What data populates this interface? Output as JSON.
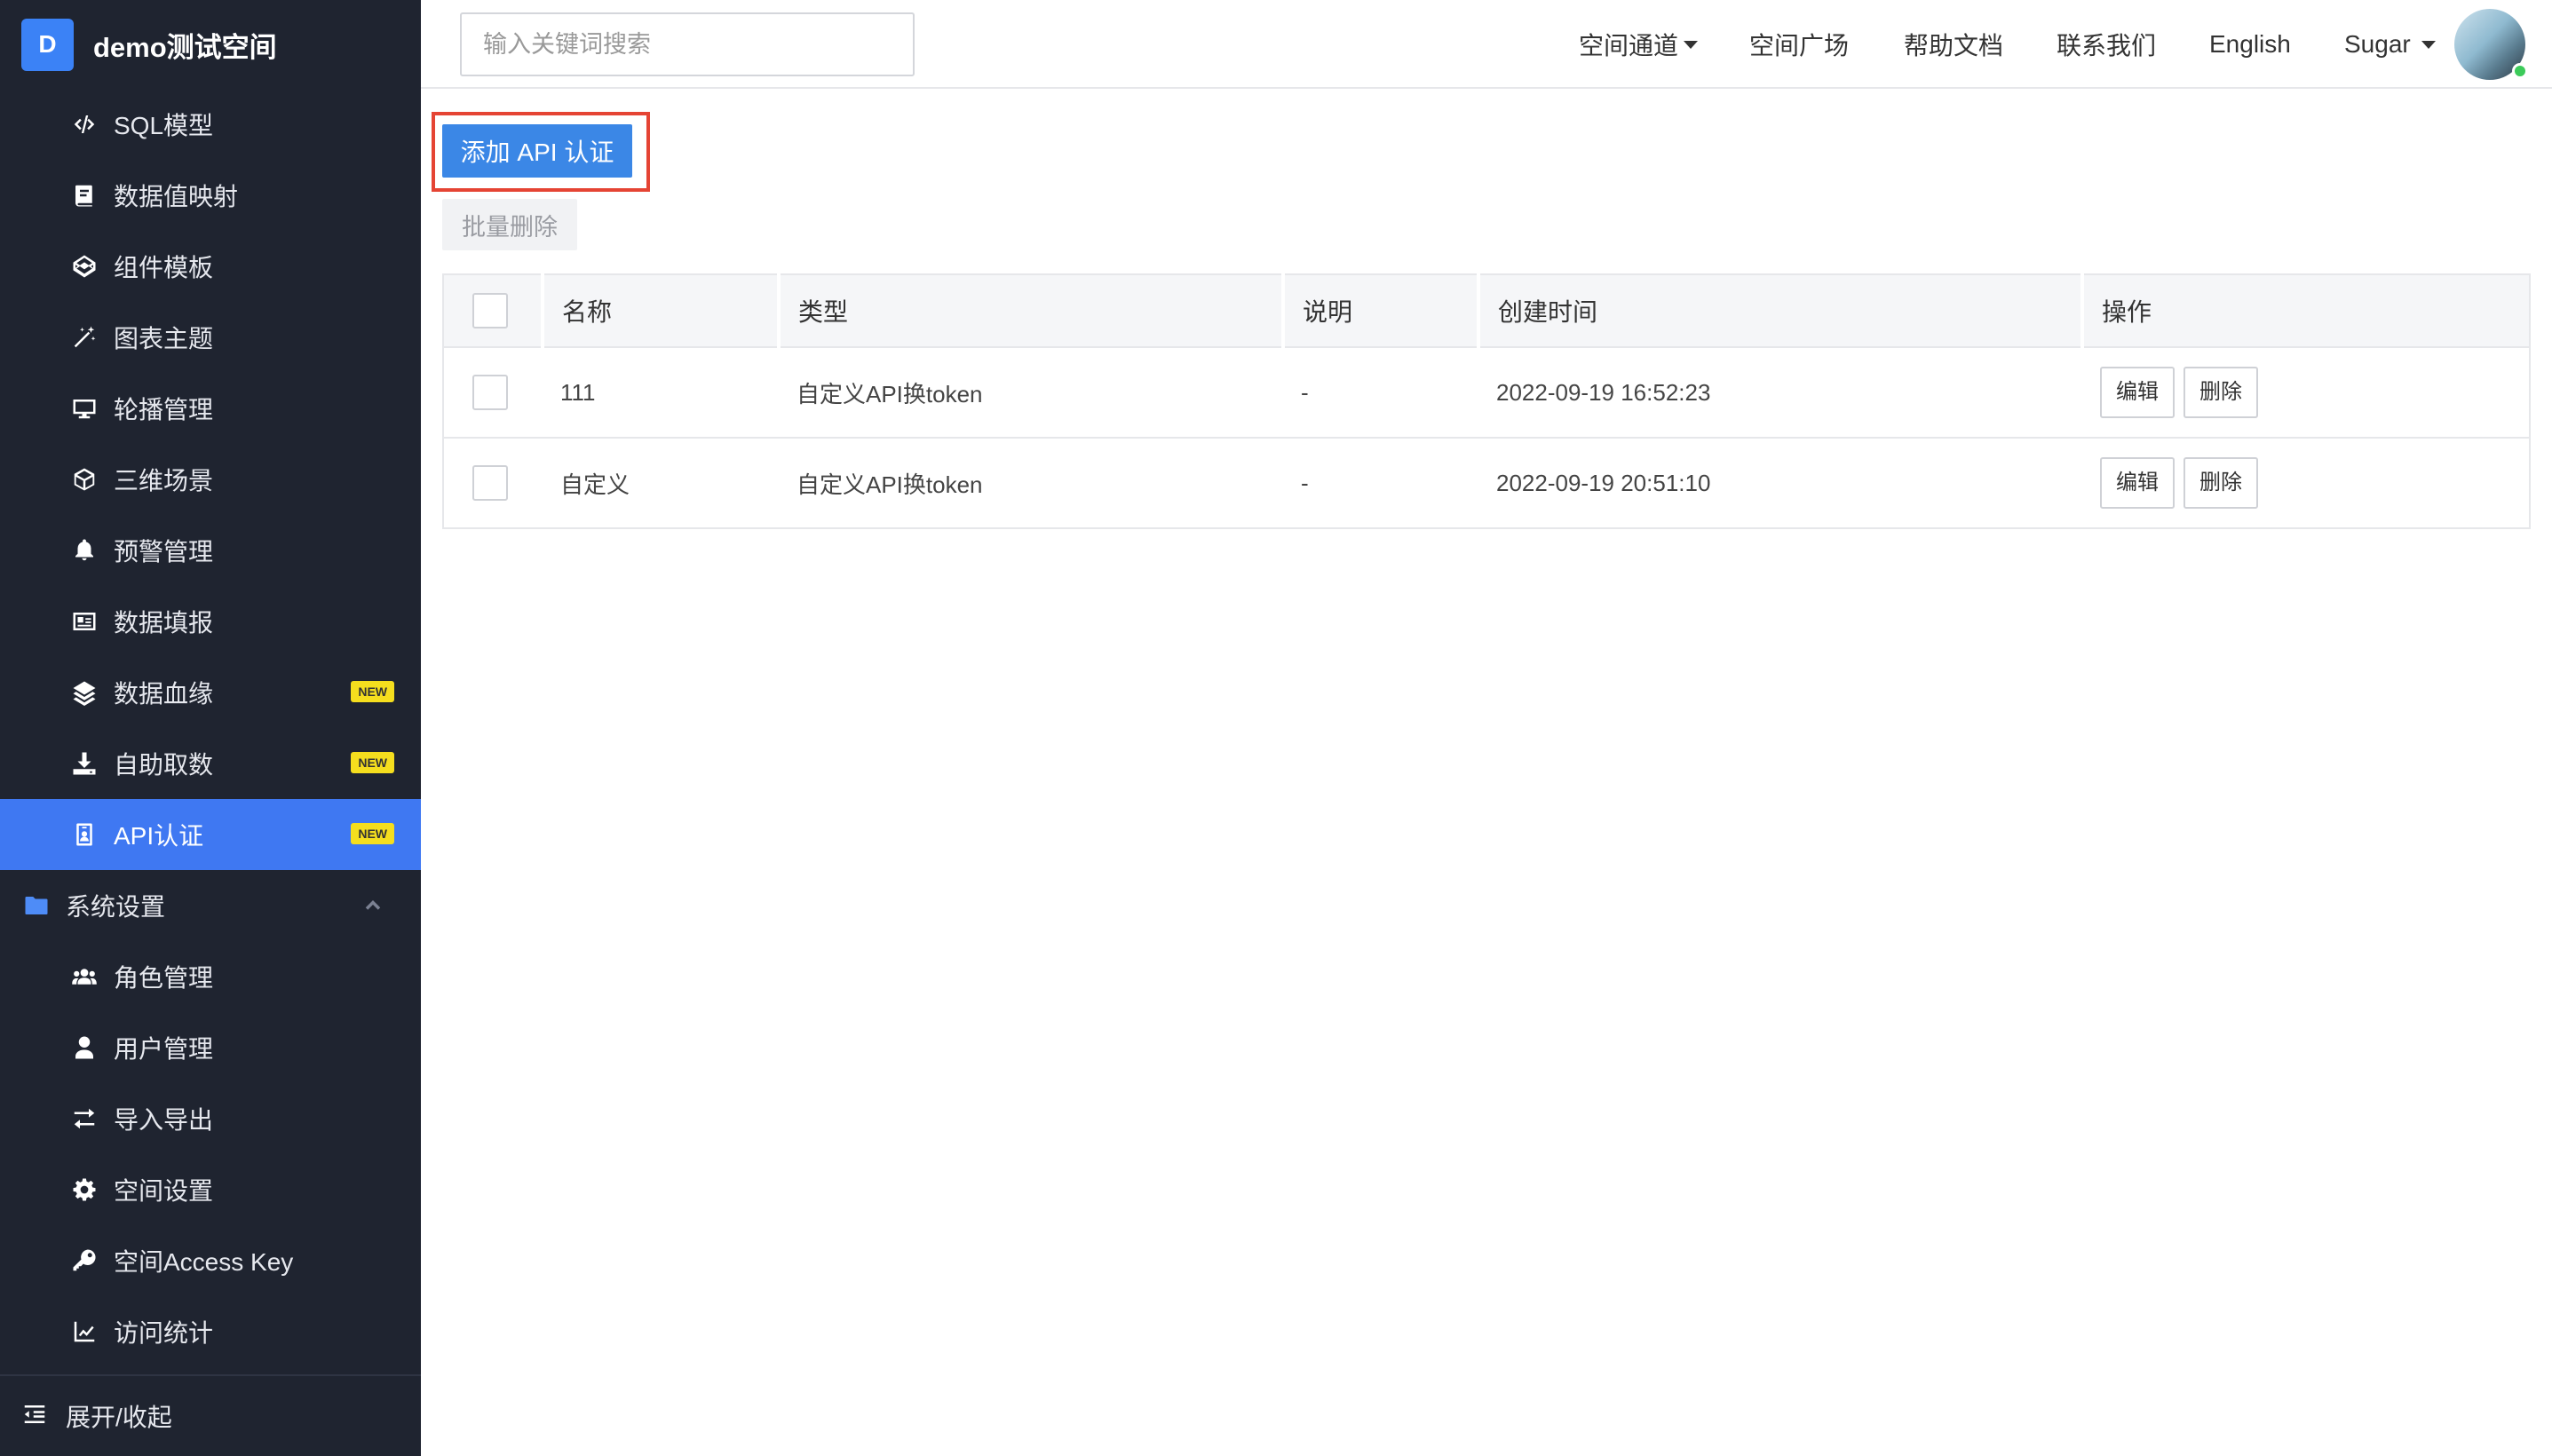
{
  "brand": {
    "logo": "D",
    "name": "demo测试空间"
  },
  "sidebar": {
    "items": [
      {
        "label": "SQL模型",
        "icon": "code-icon",
        "new": false
      },
      {
        "label": "数据值映射",
        "icon": "book-icon",
        "new": false
      },
      {
        "label": "组件模板",
        "icon": "codepen-icon",
        "new": false
      },
      {
        "label": "图表主题",
        "icon": "magic-wand-icon",
        "new": false
      },
      {
        "label": "轮播管理",
        "icon": "monitor-icon",
        "new": false
      },
      {
        "label": "三维场景",
        "icon": "cube-icon",
        "new": false
      },
      {
        "label": "预警管理",
        "icon": "bell-icon",
        "new": false
      },
      {
        "label": "数据填报",
        "icon": "id-card-icon",
        "new": false
      },
      {
        "label": "数据血缘",
        "icon": "layers-icon",
        "new": true
      },
      {
        "label": "自助取数",
        "icon": "download-icon",
        "new": true
      },
      {
        "label": "API认证",
        "icon": "badge-icon",
        "new": true,
        "active": true
      }
    ],
    "group": {
      "label": "系统设置",
      "icon": "folder-icon",
      "expanded": true
    },
    "group_items": [
      {
        "label": "角色管理",
        "icon": "users-icon"
      },
      {
        "label": "用户管理",
        "icon": "user-icon"
      },
      {
        "label": "导入导出",
        "icon": "exchange-icon"
      },
      {
        "label": "空间设置",
        "icon": "cog-icon"
      },
      {
        "label": "空间Access Key",
        "icon": "key-icon"
      },
      {
        "label": "访问统计",
        "icon": "line-chart-icon"
      }
    ],
    "new_badge": "NEW",
    "footer": {
      "label": "展开/收起",
      "icon": "indent-icon"
    }
  },
  "header": {
    "search_placeholder": "输入关键词搜索",
    "nav": [
      "空间通道",
      "空间广场",
      "帮助文档",
      "联系我们",
      "English"
    ],
    "user": "Sugar"
  },
  "actions": {
    "add": "添加 API 认证",
    "bulk_delete": "批量删除"
  },
  "table": {
    "columns": [
      "名称",
      "类型",
      "说明",
      "创建时间",
      "操作"
    ],
    "rows": [
      {
        "name": "111",
        "type": "自定义API换token",
        "desc": "-",
        "created": "2022-09-19 16:52:23"
      },
      {
        "name": "自定义",
        "type": "自定义API换token",
        "desc": "-",
        "created": "2022-09-19 20:51:10"
      }
    ],
    "edit_label": "编辑",
    "delete_label": "删除"
  },
  "colors": {
    "sidebar_bg": "#1f2430",
    "active": "#3f78f2",
    "primary": "#3b87e6",
    "highlight": "#e54434",
    "badge": "#f5de1e"
  }
}
